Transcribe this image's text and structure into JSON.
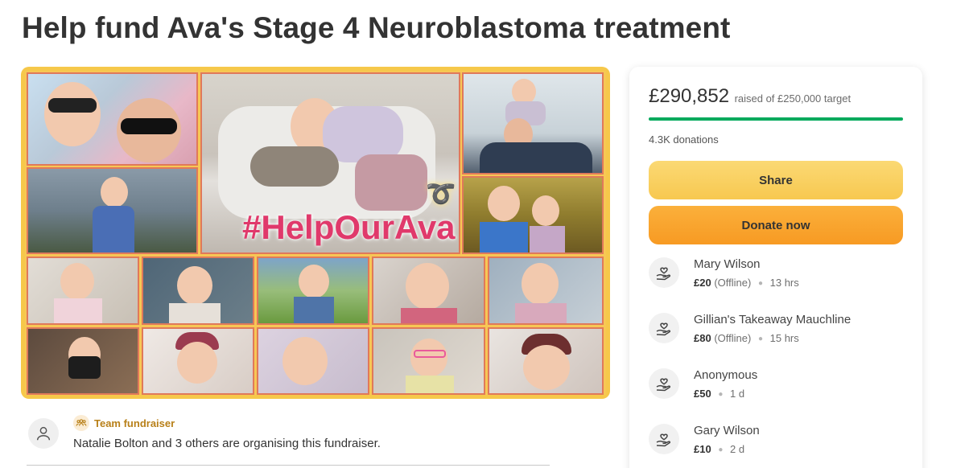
{
  "page": {
    "title": "Help fund Ava's Stage 4 Neuroblastoma treatment"
  },
  "hero": {
    "hashtag": "#HelpOurAva",
    "ribbon_icon": "awareness-ribbon-icon"
  },
  "organizer": {
    "avatar_icon": "user-icon",
    "team_icon": "team-icon",
    "team_label": "Team fundraiser",
    "description": "Natalie Bolton and 3 others are organising this fundraiser."
  },
  "sidebar": {
    "raised_amount": "£290,852",
    "raised_of": "raised of £250,000 target",
    "progress_fraction": 1.0,
    "donations_count": "4.3K donations",
    "share_label": "Share",
    "donate_label": "Donate now",
    "donors": [
      {
        "name": "Mary Wilson",
        "amount": "£20",
        "note": "(Offline)",
        "time": "13 hrs"
      },
      {
        "name": "Gillian's Takeaway Mauchline",
        "amount": "£80",
        "note": "(Offline)",
        "time": "15 hrs"
      },
      {
        "name": "Anonymous",
        "amount": "£50",
        "note": "",
        "time": "1 d"
      },
      {
        "name": "Gary Wilson",
        "amount": "£10",
        "note": "",
        "time": "2 d"
      }
    ],
    "donor_icon": "heart-in-hand-icon"
  },
  "colors": {
    "progress": "#02a95c",
    "share": "#f9cf62",
    "donate": "#f9a530",
    "team_accent": "#b88019",
    "hashtag": "#e0396b"
  }
}
